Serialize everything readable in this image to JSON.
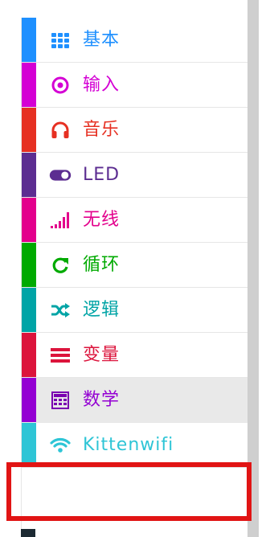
{
  "toolbox": {
    "categories": [
      {
        "label": "基本",
        "color": "#1e90ff",
        "icon": "grid-icon"
      },
      {
        "label": "输入",
        "color": "#d400d4",
        "icon": "target-icon"
      },
      {
        "label": "音乐",
        "color": "#e63022",
        "icon": "headphones-icon"
      },
      {
        "label": "LED",
        "color": "#5c2d91",
        "icon": "toggle-icon"
      },
      {
        "label": "无线",
        "color": "#e3008c",
        "icon": "signal-bars-icon"
      },
      {
        "label": "循环",
        "color": "#00aa00",
        "icon": "refresh-icon"
      },
      {
        "label": "逻辑",
        "color": "#00a4a6",
        "icon": "shuffle-icon"
      },
      {
        "label": "变量",
        "color": "#dc143c",
        "icon": "hamburger-lines-icon"
      },
      {
        "label": "数学",
        "color": "#9400d3",
        "icon": "calculator-icon"
      },
      {
        "label": "Kittenwifi",
        "color": "#2ec5d6",
        "icon": "wifi-icon"
      }
    ]
  },
  "highlight": {
    "color": "#e11414",
    "target_label": "Kittenwifi"
  }
}
